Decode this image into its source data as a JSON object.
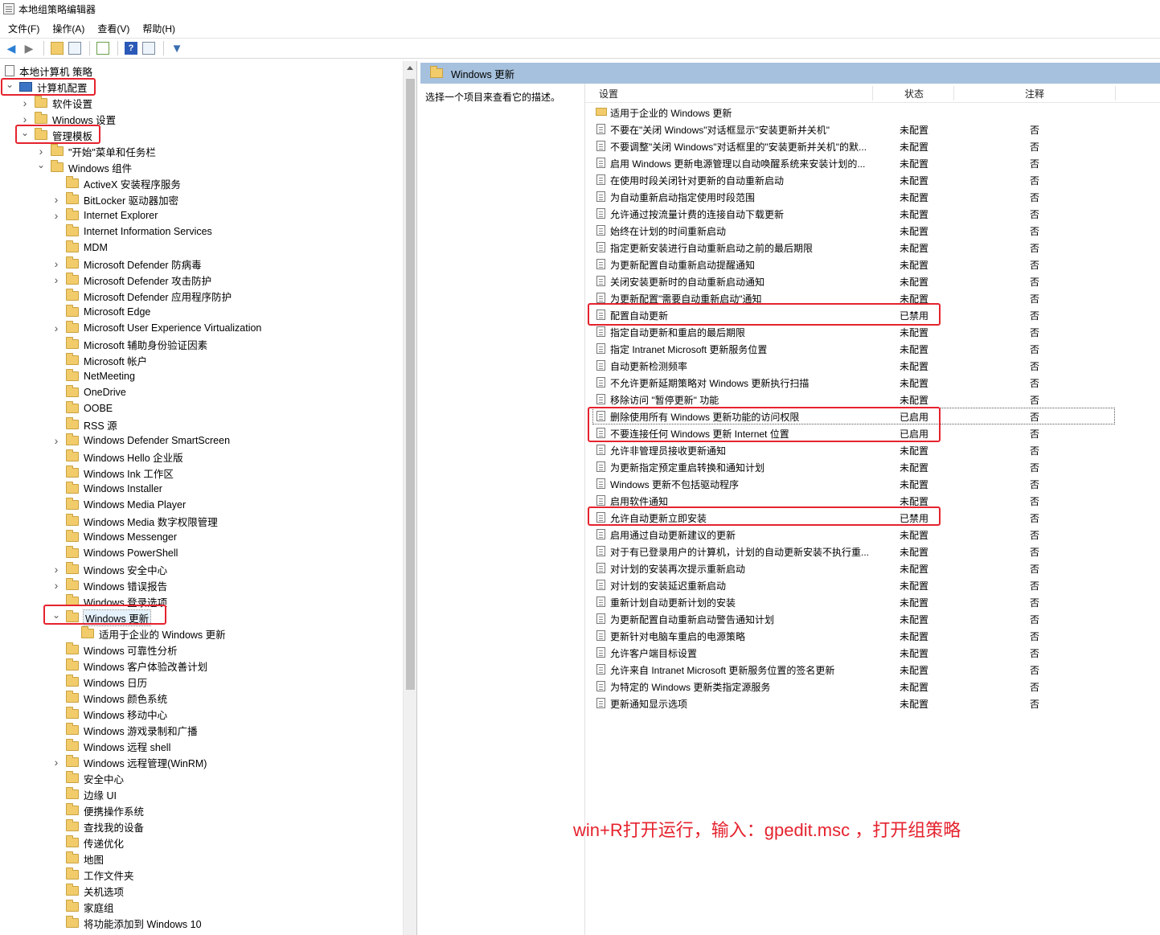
{
  "window": {
    "title": "本地组策略编辑器"
  },
  "menu": [
    "文件(F)",
    "操作(A)",
    "查看(V)",
    "帮助(H)"
  ],
  "toolbar": [
    "back-icon",
    "forward-icon",
    "up-icon",
    "show-hide-tree-icon",
    "export-icon",
    "help-icon",
    "properties-icon",
    "filter-icon"
  ],
  "tree": [
    {
      "label": "本地计算机 策略",
      "depth": 0,
      "exp": "",
      "icon": "doc"
    },
    {
      "label": "计算机配置",
      "depth": 0,
      "exp": "open",
      "icon": "pc"
    },
    {
      "label": "软件设置",
      "depth": 1,
      "exp": "closed",
      "icon": "folder"
    },
    {
      "label": "Windows 设置",
      "depth": 1,
      "exp": "closed",
      "icon": "folder"
    },
    {
      "label": "管理模板",
      "depth": 1,
      "exp": "open",
      "icon": "folder"
    },
    {
      "label": "\"开始\"菜单和任务栏",
      "depth": 2,
      "exp": "closed",
      "icon": "folder"
    },
    {
      "label": "Windows 组件",
      "depth": 2,
      "exp": "open",
      "icon": "folder"
    },
    {
      "label": "ActiveX 安装程序服务",
      "depth": 3,
      "exp": "",
      "icon": "folder"
    },
    {
      "label": "BitLocker 驱动器加密",
      "depth": 3,
      "exp": "closed",
      "icon": "folder"
    },
    {
      "label": "Internet Explorer",
      "depth": 3,
      "exp": "closed",
      "icon": "folder"
    },
    {
      "label": "Internet Information Services",
      "depth": 3,
      "exp": "",
      "icon": "folder"
    },
    {
      "label": "MDM",
      "depth": 3,
      "exp": "",
      "icon": "folder"
    },
    {
      "label": "Microsoft Defender 防病毒",
      "depth": 3,
      "exp": "closed",
      "icon": "folder"
    },
    {
      "label": "Microsoft Defender 攻击防护",
      "depth": 3,
      "exp": "closed",
      "icon": "folder"
    },
    {
      "label": "Microsoft Defender 应用程序防护",
      "depth": 3,
      "exp": "",
      "icon": "folder"
    },
    {
      "label": "Microsoft Edge",
      "depth": 3,
      "exp": "",
      "icon": "folder"
    },
    {
      "label": "Microsoft User Experience Virtualization",
      "depth": 3,
      "exp": "closed",
      "icon": "folder"
    },
    {
      "label": "Microsoft 辅助身份验证因素",
      "depth": 3,
      "exp": "",
      "icon": "folder"
    },
    {
      "label": "Microsoft 帐户",
      "depth": 3,
      "exp": "",
      "icon": "folder"
    },
    {
      "label": "NetMeeting",
      "depth": 3,
      "exp": "",
      "icon": "folder"
    },
    {
      "label": "OneDrive",
      "depth": 3,
      "exp": "",
      "icon": "folder"
    },
    {
      "label": "OOBE",
      "depth": 3,
      "exp": "",
      "icon": "folder"
    },
    {
      "label": "RSS 源",
      "depth": 3,
      "exp": "",
      "icon": "folder"
    },
    {
      "label": "Windows Defender SmartScreen",
      "depth": 3,
      "exp": "closed",
      "icon": "folder"
    },
    {
      "label": "Windows Hello 企业版",
      "depth": 3,
      "exp": "",
      "icon": "folder"
    },
    {
      "label": "Windows Ink 工作区",
      "depth": 3,
      "exp": "",
      "icon": "folder"
    },
    {
      "label": "Windows Installer",
      "depth": 3,
      "exp": "",
      "icon": "folder"
    },
    {
      "label": "Windows Media Player",
      "depth": 3,
      "exp": "",
      "icon": "folder"
    },
    {
      "label": "Windows Media 数字权限管理",
      "depth": 3,
      "exp": "",
      "icon": "folder"
    },
    {
      "label": "Windows Messenger",
      "depth": 3,
      "exp": "",
      "icon": "folder"
    },
    {
      "label": "Windows PowerShell",
      "depth": 3,
      "exp": "",
      "icon": "folder"
    },
    {
      "label": "Windows 安全中心",
      "depth": 3,
      "exp": "closed",
      "icon": "folder"
    },
    {
      "label": "Windows 错误报告",
      "depth": 3,
      "exp": "closed",
      "icon": "folder"
    },
    {
      "label": "Windows 登录选项",
      "depth": 3,
      "exp": "",
      "icon": "folder"
    },
    {
      "label": "Windows 更新",
      "depth": 3,
      "exp": "open",
      "icon": "folder",
      "selected": true
    },
    {
      "label": "适用于企业的 Windows 更新",
      "depth": 4,
      "exp": "",
      "icon": "folder"
    },
    {
      "label": "Windows 可靠性分析",
      "depth": 3,
      "exp": "",
      "icon": "folder"
    },
    {
      "label": "Windows 客户体验改善计划",
      "depth": 3,
      "exp": "",
      "icon": "folder"
    },
    {
      "label": "Windows 日历",
      "depth": 3,
      "exp": "",
      "icon": "folder"
    },
    {
      "label": "Windows 颜色系统",
      "depth": 3,
      "exp": "",
      "icon": "folder"
    },
    {
      "label": "Windows 移动中心",
      "depth": 3,
      "exp": "",
      "icon": "folder"
    },
    {
      "label": "Windows 游戏录制和广播",
      "depth": 3,
      "exp": "",
      "icon": "folder"
    },
    {
      "label": "Windows 远程 shell",
      "depth": 3,
      "exp": "",
      "icon": "folder"
    },
    {
      "label": "Windows 远程管理(WinRM)",
      "depth": 3,
      "exp": "closed",
      "icon": "folder"
    },
    {
      "label": "安全中心",
      "depth": 3,
      "exp": "",
      "icon": "folder"
    },
    {
      "label": "边缘 UI",
      "depth": 3,
      "exp": "",
      "icon": "folder"
    },
    {
      "label": "便携操作系统",
      "depth": 3,
      "exp": "",
      "icon": "folder"
    },
    {
      "label": "查找我的设备",
      "depth": 3,
      "exp": "",
      "icon": "folder"
    },
    {
      "label": "传递优化",
      "depth": 3,
      "exp": "",
      "icon": "folder"
    },
    {
      "label": "地图",
      "depth": 3,
      "exp": "",
      "icon": "folder"
    },
    {
      "label": "工作文件夹",
      "depth": 3,
      "exp": "",
      "icon": "folder"
    },
    {
      "label": "关机选项",
      "depth": 3,
      "exp": "",
      "icon": "folder"
    },
    {
      "label": "家庭组",
      "depth": 3,
      "exp": "",
      "icon": "folder"
    },
    {
      "label": "将功能添加到 Windows 10",
      "depth": 3,
      "exp": "",
      "icon": "folder"
    }
  ],
  "right": {
    "header": "Windows 更新",
    "description": "选择一个项目来查看它的描述。",
    "columns": {
      "setting": "设置",
      "state": "状态",
      "note": "注释"
    }
  },
  "policies": [
    {
      "name": "适用于企业的 Windows 更新",
      "state": "",
      "note": "",
      "folder": true
    },
    {
      "name": "不要在\"关闭 Windows\"对话框显示\"安装更新并关机\"",
      "state": "未配置",
      "note": "否"
    },
    {
      "name": "不要调整\"关闭 Windows\"对话框里的\"安装更新并关机\"的默...",
      "state": "未配置",
      "note": "否"
    },
    {
      "name": "启用 Windows 更新电源管理以自动唤醒系统来安装计划的...",
      "state": "未配置",
      "note": "否"
    },
    {
      "name": "在使用时段关闭针对更新的自动重新启动",
      "state": "未配置",
      "note": "否"
    },
    {
      "name": "为自动重新启动指定使用时段范围",
      "state": "未配置",
      "note": "否"
    },
    {
      "name": "允许通过按流量计费的连接自动下载更新",
      "state": "未配置",
      "note": "否"
    },
    {
      "name": "始终在计划的时间重新启动",
      "state": "未配置",
      "note": "否"
    },
    {
      "name": "指定更新安装进行自动重新启动之前的最后期限",
      "state": "未配置",
      "note": "否"
    },
    {
      "name": "为更新配置自动重新启动提醒通知",
      "state": "未配置",
      "note": "否"
    },
    {
      "name": "关闭安装更新时的自动重新启动通知",
      "state": "未配置",
      "note": "否"
    },
    {
      "name": "为更新配置\"需要自动重新启动\"通知",
      "state": "未配置",
      "note": "否"
    },
    {
      "name": "配置自动更新",
      "state": "已禁用",
      "note": "否"
    },
    {
      "name": "指定自动更新和重启的最后期限",
      "state": "未配置",
      "note": "否"
    },
    {
      "name": "指定 Intranet Microsoft 更新服务位置",
      "state": "未配置",
      "note": "否"
    },
    {
      "name": "自动更新检测频率",
      "state": "未配置",
      "note": "否"
    },
    {
      "name": "不允许更新延期策略对 Windows 更新执行扫描",
      "state": "未配置",
      "note": "否"
    },
    {
      "name": "移除访问 \"暂停更新\" 功能",
      "state": "未配置",
      "note": "否"
    },
    {
      "name": "删除使用所有 Windows 更新功能的访问权限",
      "state": "已启用",
      "note": "否"
    },
    {
      "name": "不要连接任何 Windows 更新 Internet 位置",
      "state": "已启用",
      "note": "否"
    },
    {
      "name": "允许非管理员接收更新通知",
      "state": "未配置",
      "note": "否"
    },
    {
      "name": "为更新指定预定重启转换和通知计划",
      "state": "未配置",
      "note": "否"
    },
    {
      "name": "Windows 更新不包括驱动程序",
      "state": "未配置",
      "note": "否"
    },
    {
      "name": "启用软件通知",
      "state": "未配置",
      "note": "否"
    },
    {
      "name": "允许自动更新立即安装",
      "state": "已禁用",
      "note": "否"
    },
    {
      "name": "启用通过自动更新建议的更新",
      "state": "未配置",
      "note": "否"
    },
    {
      "name": "对于有已登录用户的计算机，计划的自动更新安装不执行重...",
      "state": "未配置",
      "note": "否"
    },
    {
      "name": "对计划的安装再次提示重新启动",
      "state": "未配置",
      "note": "否"
    },
    {
      "name": "对计划的安装延迟重新启动",
      "state": "未配置",
      "note": "否"
    },
    {
      "name": "重新计划自动更新计划的安装",
      "state": "未配置",
      "note": "否"
    },
    {
      "name": "为更新配置自动重新启动警告通知计划",
      "state": "未配置",
      "note": "否"
    },
    {
      "name": "更新针对电脑车重启的电源策略",
      "state": "未配置",
      "note": "否"
    },
    {
      "name": "允许客户端目标设置",
      "state": "未配置",
      "note": "否"
    },
    {
      "name": "允许来自 Intranet Microsoft 更新服务位置的签名更新",
      "state": "未配置",
      "note": "否"
    },
    {
      "name": "为特定的 Windows 更新类指定源服务",
      "state": "未配置",
      "note": "否"
    },
    {
      "name": "更新通知显示选项",
      "state": "未配置",
      "note": "否"
    }
  ],
  "caption": "win+R打开运行，输入：gpedit.msc ，打开组策略",
  "colors": {
    "highlight": "#e5232e",
    "header": "#a6c1dd"
  }
}
